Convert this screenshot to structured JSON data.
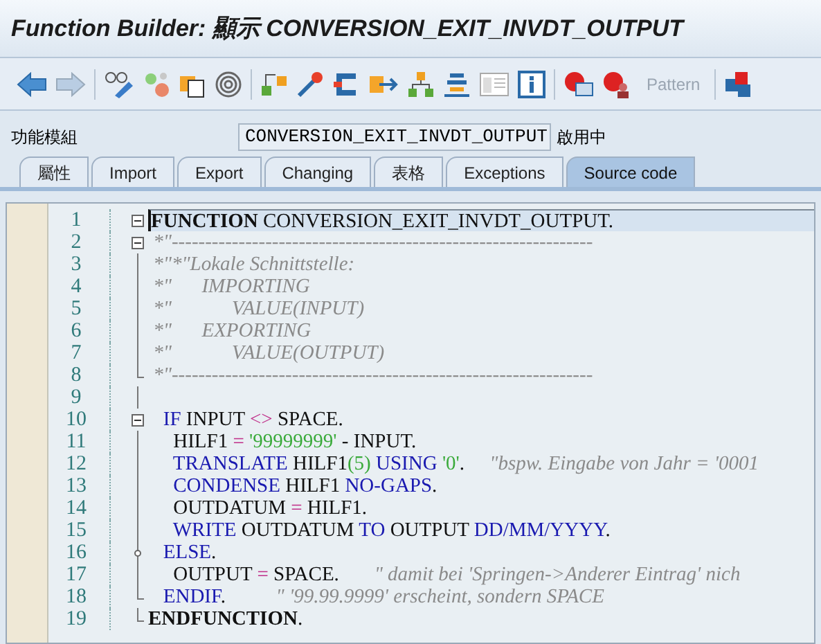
{
  "window": {
    "title": "Function Builder: 顯示 CONVERSION_EXIT_INVDT_OUTPUT"
  },
  "toolbar": {
    "pattern_button": {
      "label": "Pattern",
      "disabled": true
    }
  },
  "header": {
    "label": "功能模組",
    "value": "CONVERSION_EXIT_INVDT_OUTPUT",
    "status": "啟用中"
  },
  "tabs": [
    {
      "label": "屬性",
      "selected": false
    },
    {
      "label": "Import",
      "selected": false
    },
    {
      "label": "Export",
      "selected": false
    },
    {
      "label": "Changing",
      "selected": false
    },
    {
      "label": "表格",
      "selected": false
    },
    {
      "label": "Exceptions",
      "selected": false
    },
    {
      "label": "Source code",
      "selected": true
    }
  ],
  "editor": {
    "lines": [
      {
        "number": "1",
        "current": true,
        "kind": "collapse",
        "tokens": [
          {
            "kind": "bold",
            "text": "FUNCTION"
          },
          {
            "kind": "plain",
            "text": " CONVERSION_EXIT_INVDT_OUTPUT."
          }
        ]
      },
      {
        "number": "2",
        "current": false,
        "kind": "collapse",
        "tokens": [
          {
            "kind": "comment",
            "text": " *\"---------------------------------------------------------------"
          }
        ]
      },
      {
        "number": "3",
        "current": false,
        "kind": "line",
        "tokens": [
          {
            "kind": "comment",
            "text": " *\"*\"Lokale Schnittstelle:"
          }
        ]
      },
      {
        "number": "4",
        "current": false,
        "kind": "line",
        "tokens": [
          {
            "kind": "comment",
            "text": " *\"      IMPORTING"
          }
        ]
      },
      {
        "number": "5",
        "current": false,
        "kind": "line",
        "tokens": [
          {
            "kind": "comment",
            "text": " *\"            VALUE(INPUT)"
          }
        ]
      },
      {
        "number": "6",
        "current": false,
        "kind": "line",
        "tokens": [
          {
            "kind": "comment",
            "text": " *\"      EXPORTING"
          }
        ]
      },
      {
        "number": "7",
        "current": false,
        "kind": "line",
        "tokens": [
          {
            "kind": "comment",
            "text": " *\"            VALUE(OUTPUT)"
          }
        ]
      },
      {
        "number": "8",
        "current": false,
        "kind": "end",
        "tokens": [
          {
            "kind": "comment",
            "text": " *\"---------------------------------------------------------------"
          }
        ]
      },
      {
        "number": "9",
        "current": false,
        "kind": "line"
      },
      {
        "number": "10",
        "current": false,
        "kind": "collapse",
        "tokens": [
          {
            "kind": "keyword",
            "text": "   IF"
          },
          {
            "kind": "plain",
            "text": " INPUT "
          },
          {
            "kind": "operator",
            "text": "<>"
          },
          {
            "kind": "plain",
            "text": " SPACE."
          }
        ]
      },
      {
        "number": "11",
        "current": false,
        "kind": "line",
        "tokens": [
          {
            "kind": "plain",
            "text": "     HILF1 "
          },
          {
            "kind": "operator",
            "text": "="
          },
          {
            "kind": "string",
            "text": " '99999999'"
          },
          {
            "kind": "plain",
            "text": " - INPUT."
          }
        ]
      },
      {
        "number": "12",
        "current": false,
        "kind": "line",
        "tokens": [
          {
            "kind": "keyword",
            "text": "     TRANSLATE"
          },
          {
            "kind": "plain",
            "text": " HILF1"
          },
          {
            "kind": "string",
            "text": "(5)"
          },
          {
            "kind": "keyword",
            "text": " USING"
          },
          {
            "kind": "string",
            "text": " '0'"
          },
          {
            "kind": "plain",
            "text": "."
          },
          {
            "kind": "comment",
            "text": "     \"bspw. Eingabe von Jahr = '0001"
          }
        ]
      },
      {
        "number": "13",
        "current": false,
        "kind": "line",
        "tokens": [
          {
            "kind": "keyword",
            "text": "     CONDENSE"
          },
          {
            "kind": "plain",
            "text": " HILF1 "
          },
          {
            "kind": "keyword",
            "text": "NO-GAPS"
          },
          {
            "kind": "plain",
            "text": "."
          }
        ]
      },
      {
        "number": "14",
        "current": false,
        "kind": "line",
        "tokens": [
          {
            "kind": "plain",
            "text": "     OUTDATUM "
          },
          {
            "kind": "operator",
            "text": "="
          },
          {
            "kind": "plain",
            "text": " HILF1."
          }
        ]
      },
      {
        "number": "15",
        "current": false,
        "kind": "line",
        "tokens": [
          {
            "kind": "keyword",
            "text": "     WRITE"
          },
          {
            "kind": "plain",
            "text": " OUTDATUM "
          },
          {
            "kind": "keyword",
            "text": "TO"
          },
          {
            "kind": "plain",
            "text": " OUTPUT "
          },
          {
            "kind": "keyword",
            "text": "DD/MM/YYYY"
          },
          {
            "kind": "plain",
            "text": "."
          }
        ]
      },
      {
        "number": "16",
        "current": false,
        "kind": "branch",
        "tokens": [
          {
            "kind": "keyword",
            "text": "   ELSE"
          },
          {
            "kind": "plain",
            "text": "."
          }
        ]
      },
      {
        "number": "17",
        "current": false,
        "kind": "line",
        "tokens": [
          {
            "kind": "plain",
            "text": "     OUTPUT "
          },
          {
            "kind": "operator",
            "text": "="
          },
          {
            "kind": "plain",
            "text": " SPACE."
          },
          {
            "kind": "comment",
            "text": "       \" damit bei 'Springen->Anderer Eintrag' nich"
          }
        ]
      },
      {
        "number": "18",
        "current": false,
        "kind": "end",
        "tokens": [
          {
            "kind": "keyword",
            "text": "   ENDIF"
          },
          {
            "kind": "plain",
            "text": "."
          },
          {
            "kind": "comment",
            "text": "          \" '99.99.9999' erscheint, sondern SPACE"
          }
        ]
      },
      {
        "number": "19",
        "current": false,
        "kind": "end",
        "tokens": [
          {
            "kind": "bold",
            "text": "ENDFUNCTION"
          },
          {
            "kind": "plain",
            "text": "."
          }
        ]
      }
    ]
  }
}
